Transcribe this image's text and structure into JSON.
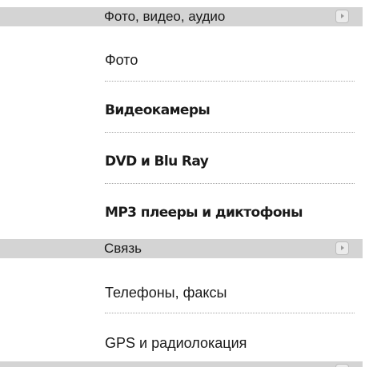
{
  "sections": [
    {
      "title": "Фото, видео, аудио",
      "items": [
        {
          "label": "Фото"
        },
        {
          "label": "Видеокамеры"
        },
        {
          "label": "DVD и Blu Ray"
        },
        {
          "label": "MP3 плееры и диктофоны"
        }
      ]
    },
    {
      "title": "Связь",
      "items": [
        {
          "label": "Телефоны, факсы"
        },
        {
          "label": "GPS и радиолокация"
        }
      ]
    }
  ],
  "colors": {
    "header_bg": "#d4d4d4",
    "text": "#1a1a1a",
    "separator": "#a8a8a8"
  },
  "icons": {
    "section_toggle": "chevron-right-icon"
  }
}
